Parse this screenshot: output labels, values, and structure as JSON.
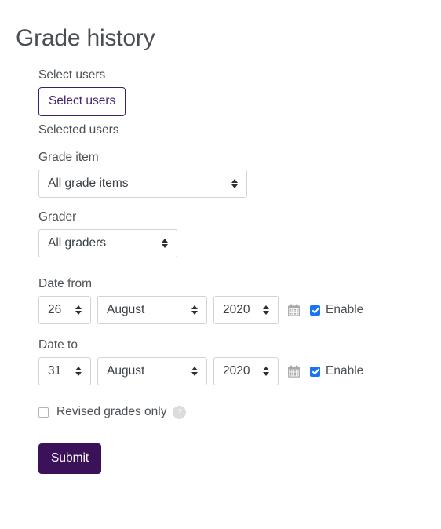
{
  "page": {
    "title": "Grade history"
  },
  "form": {
    "select_users": {
      "label": "Select users",
      "button_label": "Select users",
      "selected_users_text": "Selected users"
    },
    "grade_item": {
      "label": "Grade item",
      "value": "All grade items"
    },
    "grader": {
      "label": "Grader",
      "value": "All graders"
    },
    "date_from": {
      "label": "Date from",
      "day": "26",
      "month": "August",
      "year": "2020",
      "calendar_icon": "calendar-icon",
      "enable_label": "Enable",
      "enabled": true
    },
    "date_to": {
      "label": "Date to",
      "day": "31",
      "month": "August",
      "year": "2020",
      "calendar_icon": "calendar-icon",
      "enable_label": "Enable",
      "enabled": false
    },
    "revised_only": {
      "label": "Revised grades only",
      "checked": false,
      "help_icon_glyph": "?"
    },
    "submit": {
      "label": "Submit"
    }
  },
  "colors": {
    "primary": "#3b1159",
    "outline_border": "#391f6e",
    "outline_text": "#46216e",
    "checkbox_checked": "#1a73f0",
    "field_border": "#ced4da",
    "label_text": "#4b5156",
    "title_text": "#4a4e53",
    "help_icon_bg": "#dcdcdc"
  }
}
